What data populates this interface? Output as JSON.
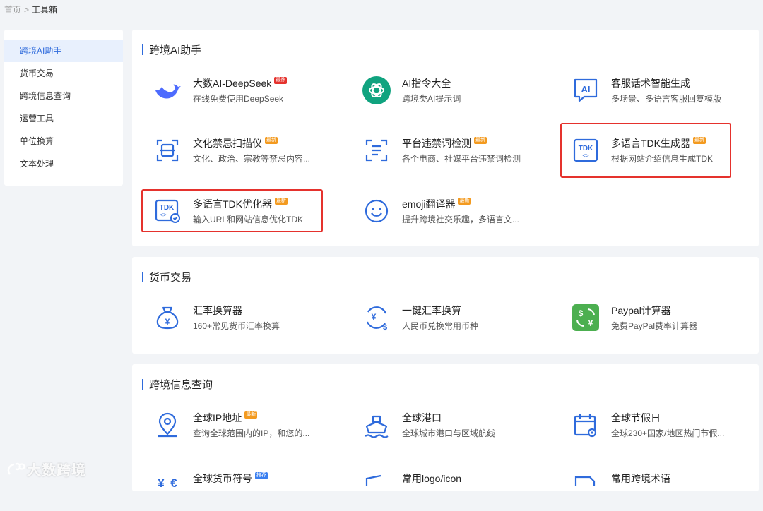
{
  "breadcrumb": {
    "home": "首页",
    "separator": ">",
    "current": "工具箱"
  },
  "sidebar": {
    "items": [
      {
        "label": "跨境AI助手",
        "active": true
      },
      {
        "label": "货币交易"
      },
      {
        "label": "跨境信息查询"
      },
      {
        "label": "运营工具"
      },
      {
        "label": "单位换算"
      },
      {
        "label": "文本处理"
      }
    ]
  },
  "sections": [
    {
      "title": "跨境AI助手",
      "tools": [
        {
          "name": "大数AI-DeepSeek",
          "desc": "在线免费使用DeepSeek",
          "badge": "最热",
          "icon": "deepseek-whale-icon"
        },
        {
          "name": "AI指令大全",
          "desc": "跨境类AI提示词",
          "icon": "openai-logo-icon"
        },
        {
          "name": "客服话术智能生成",
          "desc": "多场景、多语言客服回复模版",
          "icon": "ai-chat-icon"
        },
        {
          "name": "文化禁忌扫描仪",
          "desc": "文化、政治、宗教等禁忌内容...",
          "badge": "最新",
          "icon": "scan-icon"
        },
        {
          "name": "平台违禁词检测",
          "desc": "各个电商、社媒平台违禁词检测",
          "badge": "最新",
          "icon": "word-scan-icon"
        },
        {
          "name": "多语言TDK生成器",
          "desc": "根据网站介绍信息生成TDK",
          "badge": "最新",
          "icon": "tdk-generator-icon"
        },
        {
          "name": "多语言TDK优化器",
          "desc": "输入URL和网站信息优化TDK",
          "badge": "最新",
          "icon": "tdk-optimizer-icon"
        },
        {
          "name": "emoji翻译器",
          "desc": "提升跨境社交乐趣，多语言文...",
          "badge": "最新",
          "icon": "smiley-icon"
        }
      ]
    },
    {
      "title": "货币交易",
      "tools": [
        {
          "name": "汇率换算器",
          "desc": "160+常见货币汇率换算",
          "icon": "money-bag-icon"
        },
        {
          "name": "一键汇率换算",
          "desc": "人民币兑换常用币种",
          "icon": "currency-exchange-icon"
        },
        {
          "name": "Paypal计算器",
          "desc": "免费PayPal费率计算器",
          "icon": "paypal-calculator-icon"
        }
      ]
    },
    {
      "title": "跨境信息查询",
      "tools": [
        {
          "name": "全球IP地址",
          "desc": "查询全球范围内的IP，和您的...",
          "badge": "最新",
          "icon": "location-pin-icon"
        },
        {
          "name": "全球港口",
          "desc": "全球城市港口与区域航线",
          "icon": "ship-icon"
        },
        {
          "name": "全球节假日",
          "desc": "全球230+国家/地区热门节假...",
          "icon": "calendar-icon"
        },
        {
          "name": "全球货币符号",
          "desc": "",
          "badge": "推荐",
          "icon": "currency-symbol-icon"
        },
        {
          "name": "常用logo/icon",
          "desc": "",
          "icon": "logo-icon"
        },
        {
          "name": "常用跨境术语",
          "desc": "",
          "icon": "glossary-icon"
        }
      ]
    }
  ],
  "watermark": "大数跨境",
  "colors": {
    "accent": "#2f6bdc",
    "highlight": "#e5322d",
    "badge_new": "#f39a1f",
    "badge_hot": "#e5322d",
    "badge_rec": "#3a7ff0",
    "openai_green": "#10a37f",
    "paypal_green": "#4caf50"
  }
}
